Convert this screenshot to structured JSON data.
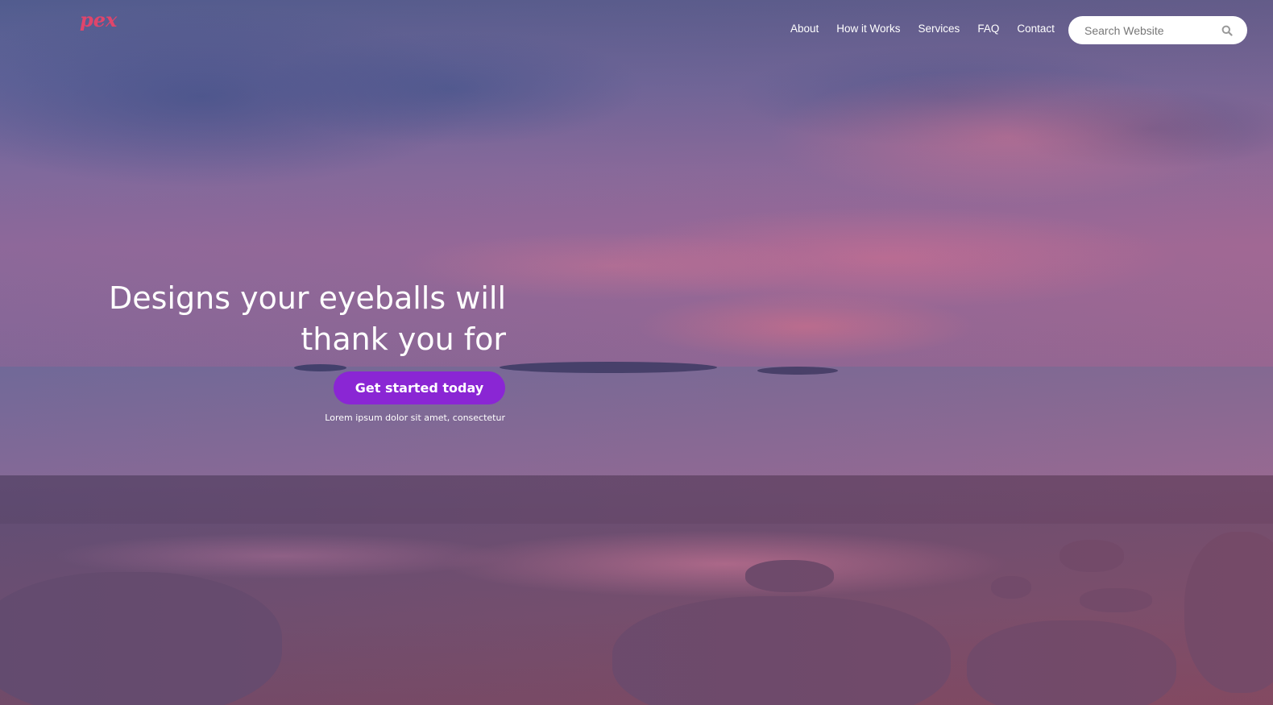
{
  "brand": {
    "logo_text": "pex",
    "logo_color": "#e0456b"
  },
  "nav": {
    "items": [
      {
        "label": "About"
      },
      {
        "label": "How it Works"
      },
      {
        "label": "Services"
      },
      {
        "label": "FAQ"
      },
      {
        "label": "Contact"
      }
    ]
  },
  "search": {
    "placeholder": "Search Website",
    "icon": "search-icon"
  },
  "hero": {
    "headline_line1": "Designs your eyeballs will",
    "headline_line2": "thank you for",
    "cta_label": "Get started today",
    "subtext": "Lorem ipsum dolor sit amet, consectetur",
    "cta_color": "#8a26d4"
  }
}
